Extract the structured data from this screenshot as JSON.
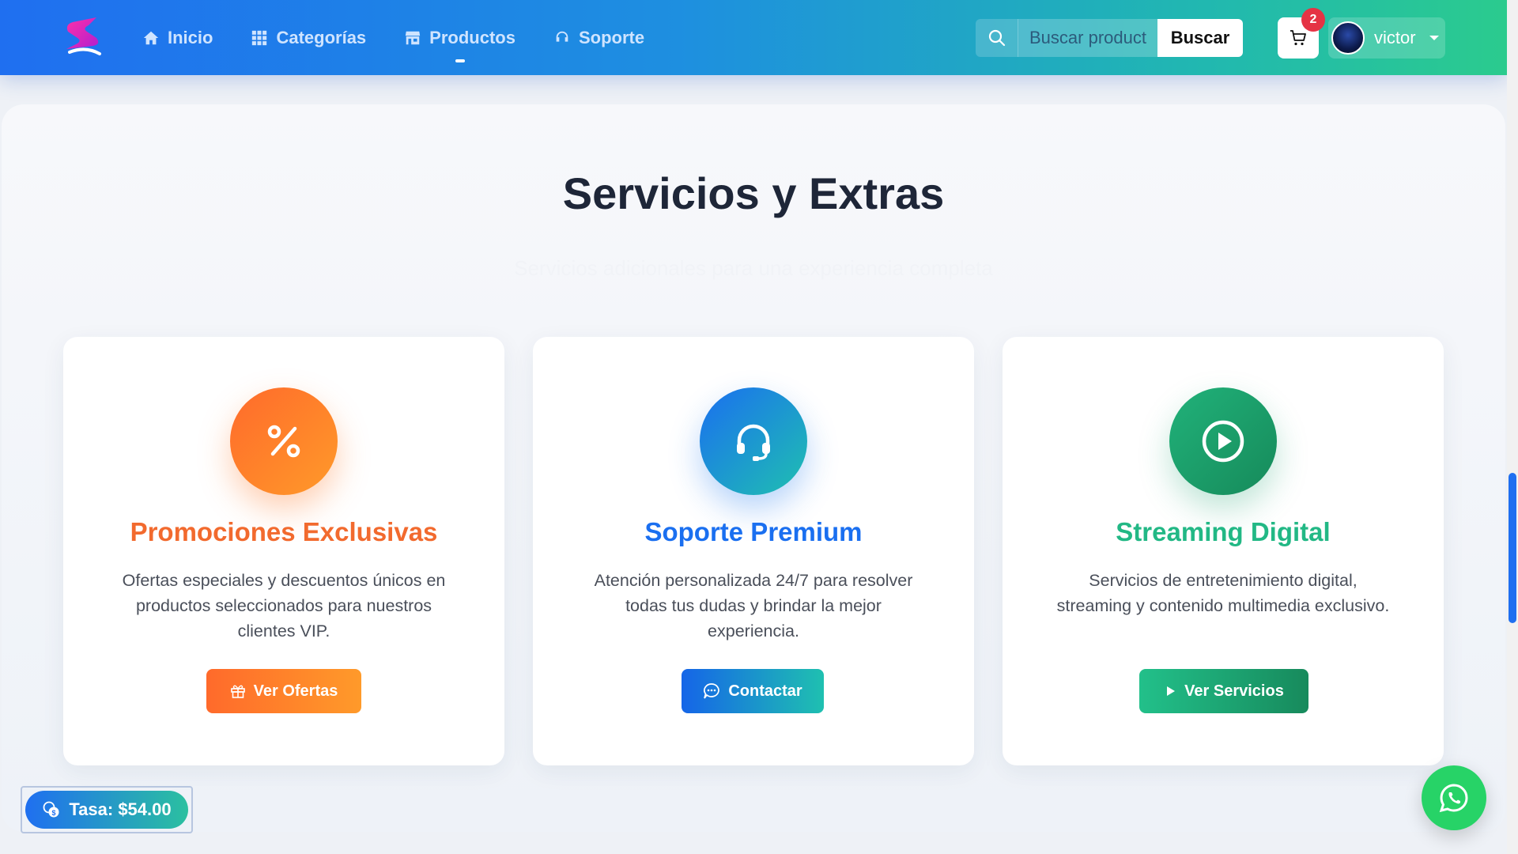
{
  "nav": {
    "items": [
      {
        "label": "Inicio",
        "icon": "home-icon"
      },
      {
        "label": "Categorías",
        "icon": "grid-icon"
      },
      {
        "label": "Productos",
        "icon": "store-icon"
      },
      {
        "label": "Soporte",
        "icon": "headset-icon"
      }
    ],
    "active": "Productos"
  },
  "search": {
    "placeholder": "Buscar productos...",
    "button_label": "Buscar"
  },
  "cart": {
    "count": "2"
  },
  "user": {
    "name": "victor"
  },
  "section": {
    "title": "Servicios y Extras",
    "subtitle": "Servicios adicionales para una experiencia completa"
  },
  "cards": [
    {
      "title": "Promociones Exclusivas",
      "description": "Ofertas especiales y descuentos únicos en productos seleccionados para nuestros clientes VIP.",
      "button_label": "Ver Ofertas",
      "icon": "percent-icon",
      "button_icon": "gift-icon",
      "accent": "#f26a2e"
    },
    {
      "title": "Soporte Premium",
      "description": "Atención personalizada 24/7 para resolver todas tus dudas y brindar la mejor experiencia.",
      "button_label": "Contactar",
      "icon": "headset-icon",
      "button_icon": "chat-icon",
      "accent": "#1a6ff0"
    },
    {
      "title": "Streaming Digital",
      "description": "Servicios de entretenimiento digital, streaming y contenido multimedia exclusivo.",
      "button_label": "Ver Servicios",
      "icon": "play-circle-icon",
      "button_icon": "play-icon",
      "accent": "#22b885"
    }
  ],
  "rate": {
    "label": "Tasa: $54.00"
  },
  "colors": {
    "nav_start": "#1f6ff0",
    "nav_end": "#2bcb8e",
    "whatsapp": "#27d367"
  }
}
